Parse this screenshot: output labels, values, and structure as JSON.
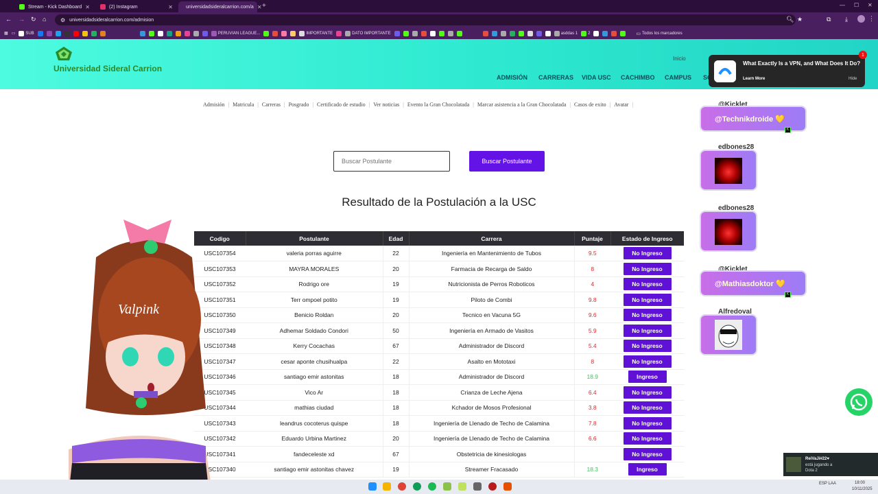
{
  "browser": {
    "tabs": [
      {
        "title": "Stream - Kick Dashboard",
        "color": "#53fc18"
      },
      {
        "title": "(2) Instagram",
        "color": "#e1306c"
      },
      {
        "title": "universidadsideralcarrion.com/a",
        "color": "#4bbf3a"
      }
    ],
    "url": "universidadsideralcarrion.com/admision",
    "bookmarks": [
      "SUB",
      "PERUVIAN LEAGUE...",
      "IMPORTANTE",
      "DATO IMPORTANTE",
      "asddas 1",
      "2",
      "Todos los marcadores"
    ]
  },
  "site": {
    "title": "Universidad Sideral Carrion",
    "inicio": "Inicio",
    "nav": [
      "ADMISIÓN",
      "CARRERAS",
      "VIDA USC",
      "CACHIMBO",
      "CAMPUS",
      "SO"
    ],
    "subnav": [
      "Admisión",
      "Matricula",
      "Carreras",
      "Posgrado",
      "Certificado de estudio",
      "Ver noticias",
      "Evento la Gran Chocolatada",
      "Marcar asistencia a la Gran Chocolatada",
      "Casos de exito",
      "Avatar"
    ],
    "search_placeholder": "Buscar Postulante",
    "search_button": "Buscar Postulante",
    "page_title": "Resultado de la Postulación a la USC"
  },
  "ad": {
    "title": "What Exactly Is a VPN, and What Does It Do?",
    "learn": "Learn More",
    "hide": "Hide",
    "badge": "1"
  },
  "table": {
    "headers": [
      "Codigo",
      "Postulante",
      "Edad",
      "Carrera",
      "Puntaje",
      "Estado de Ingreso"
    ],
    "rows": [
      {
        "codigo": "USC107354",
        "postulante": "valeria porras aguirre",
        "edad": "22",
        "carrera": "Ingeniería en Mantenimiento de Tubos",
        "puntaje": "9.5",
        "estado": "No Ingreso",
        "pass": false
      },
      {
        "codigo": "USC107353",
        "postulante": "MAYRA MORALES",
        "edad": "20",
        "carrera": "Farmacia de Recarga de Saldo",
        "puntaje": "8",
        "estado": "No Ingreso",
        "pass": false
      },
      {
        "codigo": "USC107352",
        "postulante": "Rodrigo ore",
        "edad": "19",
        "carrera": "Nutricionista de Perros Roboticos",
        "puntaje": "4",
        "estado": "No Ingreso",
        "pass": false
      },
      {
        "codigo": "USC107351",
        "postulante": "Terr ompoel potito",
        "edad": "19",
        "carrera": "Piloto de Combi",
        "puntaje": "9.8",
        "estado": "No Ingreso",
        "pass": false
      },
      {
        "codigo": "USC107350",
        "postulante": "Benicio Roldan",
        "edad": "20",
        "carrera": "Tecnico en Vacuna 5G",
        "puntaje": "9.6",
        "estado": "No Ingreso",
        "pass": false
      },
      {
        "codigo": "USC107349",
        "postulante": "Adhemar Soldado Condori",
        "edad": "50",
        "carrera": "Ingeniería en Armado de Vasitos",
        "puntaje": "5.9",
        "estado": "No Ingreso",
        "pass": false
      },
      {
        "codigo": "USC107348",
        "postulante": "Kerry Cocachas",
        "edad": "67",
        "carrera": "Administrador de Discord",
        "puntaje": "5.4",
        "estado": "No Ingreso",
        "pass": false
      },
      {
        "codigo": "USC107347",
        "postulante": "cesar aponte chusihualpa",
        "edad": "22",
        "carrera": "Asalto en Mototaxi",
        "puntaje": "8",
        "estado": "No Ingreso",
        "pass": false
      },
      {
        "codigo": "USC107346",
        "postulante": "santiago emir astonitas",
        "edad": "18",
        "carrera": "Administrador de Discord",
        "puntaje": "18.9",
        "estado": "Ingreso",
        "pass": true
      },
      {
        "codigo": "USC107345",
        "postulante": "Vico Ar",
        "edad": "18",
        "carrera": "Crianza de Leche Ajena",
        "puntaje": "6.4",
        "estado": "No Ingreso",
        "pass": false
      },
      {
        "codigo": "USC107344",
        "postulante": "mathias ciudad",
        "edad": "18",
        "carrera": "Kchador de Mosos Profesional",
        "puntaje": "3.8",
        "estado": "No Ingreso",
        "pass": false
      },
      {
        "codigo": "USC107343",
        "postulante": "leandrus cocoterus quispe",
        "edad": "18",
        "carrera": "Ingeniería de Llenado de Techo de Calamina",
        "puntaje": "7.8",
        "estado": "No Ingreso",
        "pass": false
      },
      {
        "codigo": "USC107342",
        "postulante": "Eduardo Urbina Martinez",
        "edad": "20",
        "carrera": "Ingeniería de Llenado de Techo de Calamina",
        "puntaje": "6.6",
        "estado": "No Ingreso",
        "pass": false
      },
      {
        "codigo": "USC107341",
        "postulante": "fandeceleste xd",
        "edad": "67",
        "carrera": "Obstetricia de kinesiologas",
        "puntaje": "",
        "estado": "No Ingreso",
        "pass": false
      },
      {
        "codigo": "USC107340",
        "postulante": "santiago emir astonitas chavez",
        "edad": "19",
        "carrera": "Streamer Fracasado",
        "puntaje": "18.3",
        "estado": "Ingreso",
        "pass": true
      }
    ]
  },
  "stream": {
    "avatar_text": "Valpink",
    "alerts": [
      {
        "name": "@Kicklet",
        "message": "@Technikdroide 💛"
      },
      {
        "name": "edbones28"
      },
      {
        "name": "edbones28"
      },
      {
        "name": "@Kicklet",
        "message": "@Mathiasdoktor 💛"
      },
      {
        "name": "Alfredoval"
      }
    ]
  },
  "toast": {
    "title": "ReiVaJi#22♥",
    "line1": "está jugando a",
    "line2": "Dota 2"
  },
  "taskbar": {
    "lang": "ESP LAA",
    "time": "18:00",
    "date": "10/11/2025"
  },
  "colors": {
    "header_start": "#4dfbe0",
    "accent": "#6313e6",
    "fail_score": "#d92b2b",
    "pass_score": "#3ec45a"
  }
}
